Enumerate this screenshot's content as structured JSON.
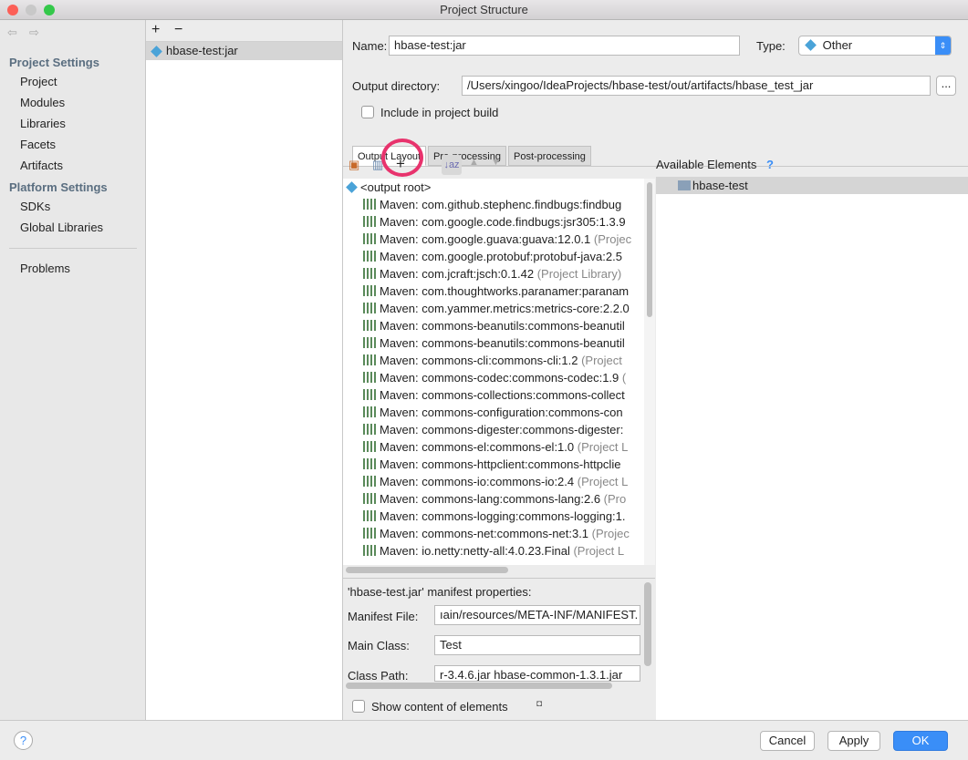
{
  "window": {
    "title": "Project Structure"
  },
  "sidebar": {
    "project_settings": "Project Settings",
    "items1": [
      "Project",
      "Modules",
      "Libraries",
      "Facets",
      "Artifacts"
    ],
    "platform_settings": "Platform Settings",
    "items2": [
      "SDKs",
      "Global Libraries"
    ],
    "problems": "Problems"
  },
  "artifacts": {
    "add": "+",
    "remove": "−",
    "selected": "hbase-test:jar"
  },
  "form": {
    "name_label": "Name:",
    "name_value": "hbase-test:jar",
    "type_label": "Type:",
    "type_value": "Other",
    "outdir_label": "Output directory:",
    "outdir_value": "/Users/xingoo/IdeaProjects/hbase-test/out/artifacts/hbase_test_jar",
    "browse": "...",
    "include_label": "Include in project build",
    "include_checked": false
  },
  "tabs": [
    "Output Layout",
    "Pre-processing",
    "Post-processing"
  ],
  "toolbar": {
    "add": "+"
  },
  "tree": {
    "root": "<output root>",
    "rows": [
      {
        "t": "Maven: com.github.stephenc.findbugs:findbug",
        "s": ""
      },
      {
        "t": "Maven: com.google.code.findbugs:jsr305:1.3.9",
        "s": ""
      },
      {
        "t": "Maven: com.google.guava:guava:12.0.1",
        "s": " (Projec"
      },
      {
        "t": "Maven: com.google.protobuf:protobuf-java:2.5",
        "s": ""
      },
      {
        "t": "Maven: com.jcraft:jsch:0.1.42",
        "s": " (Project Library)"
      },
      {
        "t": "Maven: com.thoughtworks.paranamer:paranam",
        "s": ""
      },
      {
        "t": "Maven: com.yammer.metrics:metrics-core:2.2.0",
        "s": ""
      },
      {
        "t": "Maven: commons-beanutils:commons-beanutil",
        "s": ""
      },
      {
        "t": "Maven: commons-beanutils:commons-beanutil",
        "s": ""
      },
      {
        "t": "Maven: commons-cli:commons-cli:1.2",
        "s": " (Project"
      },
      {
        "t": "Maven: commons-codec:commons-codec:1.9",
        "s": " ("
      },
      {
        "t": "Maven: commons-collections:commons-collect",
        "s": ""
      },
      {
        "t": "Maven: commons-configuration:commons-con",
        "s": ""
      },
      {
        "t": "Maven: commons-digester:commons-digester:",
        "s": ""
      },
      {
        "t": "Maven: commons-el:commons-el:1.0",
        "s": " (Project L"
      },
      {
        "t": "Maven: commons-httpclient:commons-httpclie",
        "s": ""
      },
      {
        "t": "Maven: commons-io:commons-io:2.4",
        "s": " (Project L"
      },
      {
        "t": "Maven: commons-lang:commons-lang:2.6",
        "s": " (Pro"
      },
      {
        "t": "Maven: commons-logging:commons-logging:1.",
        "s": ""
      },
      {
        "t": "Maven: commons-net:commons-net:3.1",
        "s": " (Projec"
      },
      {
        "t": "Maven: io.netty:netty-all:4.0.23.Final",
        "s": " (Project L"
      }
    ]
  },
  "available": {
    "title": "Available Elements",
    "help": "?",
    "item": "hbase-test"
  },
  "manifest": {
    "title": "'hbase-test.jar' manifest properties:",
    "file_label": "Manifest File:",
    "file_value": "ıain/resources/META-INF/MANIFEST.",
    "main_label": "Main Class:",
    "main_value": "Test",
    "cp_label": "Class Path:",
    "cp_value": "r-3.4.6.jar hbase-common-1.3.1.jar"
  },
  "show_content": {
    "label": "Show content of elements",
    "checked": false
  },
  "footer": {
    "help": "?",
    "cancel": "Cancel",
    "apply": "Apply",
    "ok": "OK"
  },
  "colors": {
    "accent": "#3a8ef7",
    "highlight": "#e8336d"
  }
}
